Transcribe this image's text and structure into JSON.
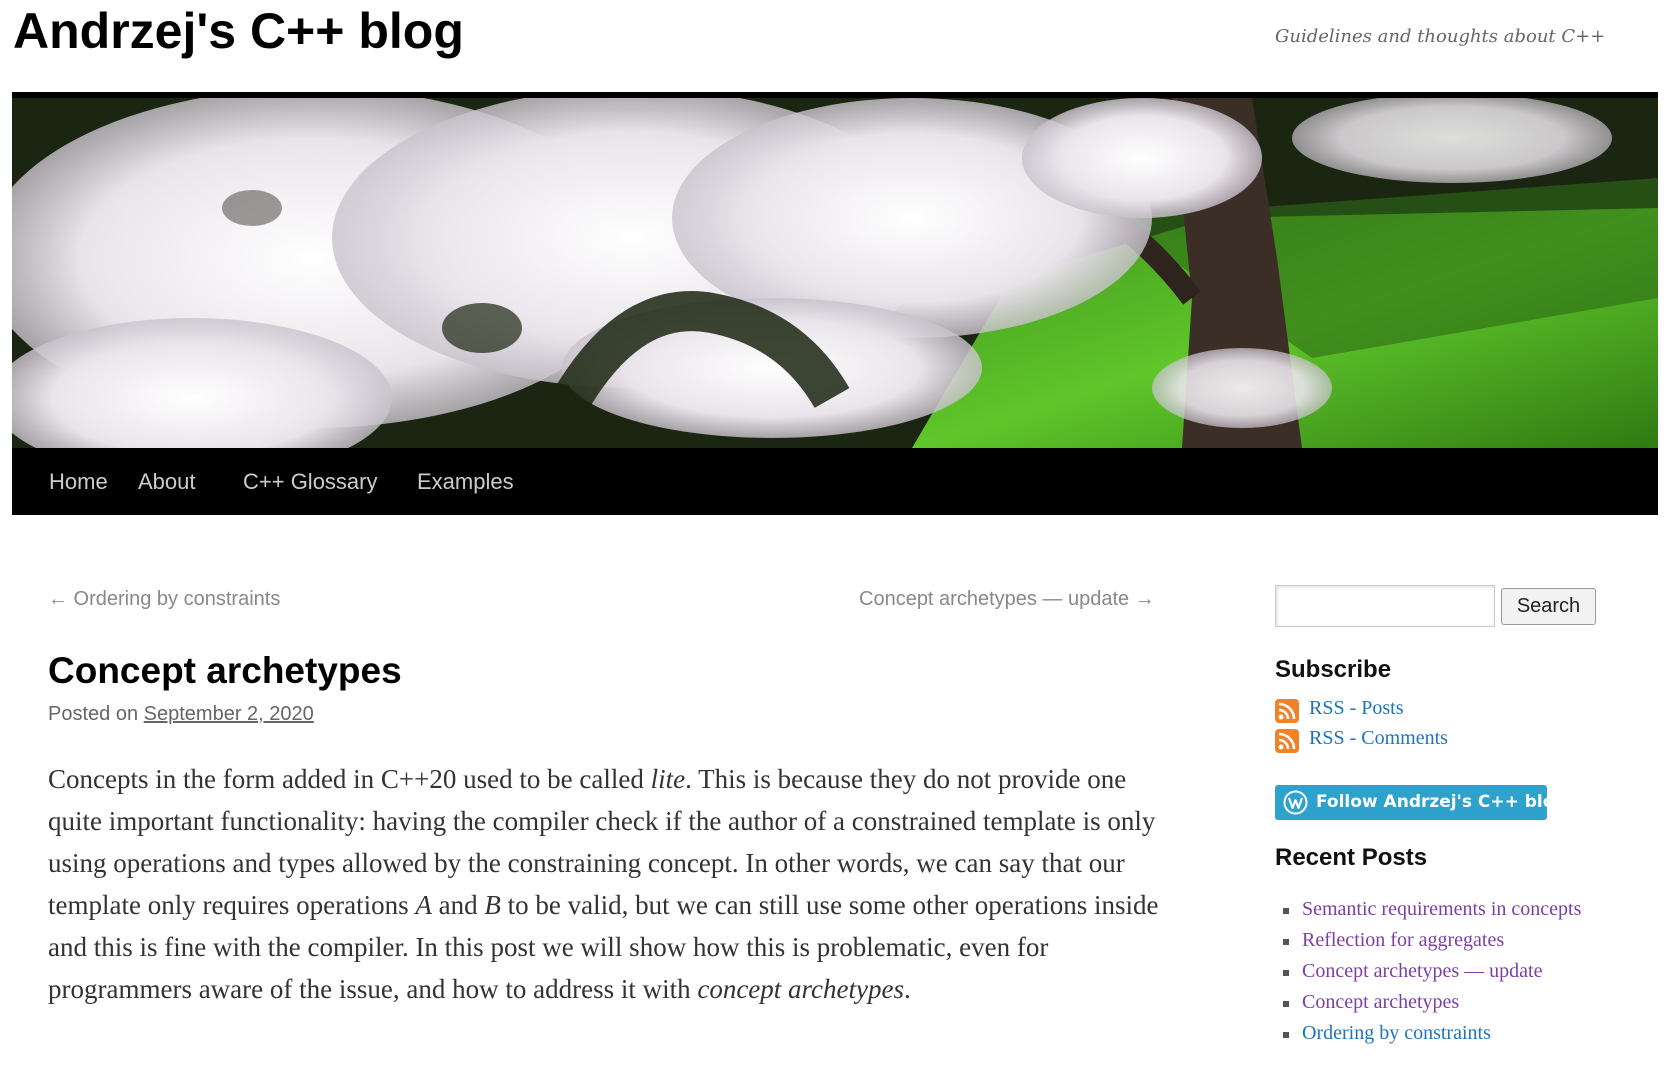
{
  "site": {
    "title": "Andrzej's C++ blog",
    "description": "Guidelines and thoughts about C++"
  },
  "nav": {
    "items": [
      {
        "label": "Home"
      },
      {
        "label": "About"
      },
      {
        "label": "C++ Glossary"
      },
      {
        "label": "Examples"
      }
    ]
  },
  "post_nav": {
    "previous": "← Ordering by constraints",
    "next": "Concept archetypes — update →"
  },
  "post": {
    "title": "Concept archetypes",
    "posted_on": "Posted on",
    "date": "September 2, 2020",
    "body": {
      "t1": "Concepts in the form added in C++20 used to be called ",
      "em1": "lite",
      "t2": ". This is because they do not provide one quite important functionality: having the compiler check if the author of a constrained template is only using operations and types allowed by the constraining concept. In other words, we can say that our template only requires operations ",
      "em2": "A",
      "t3": " and ",
      "em3": "B",
      "t4": " to be valid, but we can still use some other operations inside and this is fine with the compiler. In this post we will show how this is problematic, even for programmers aware of the issue, and how to address it with ",
      "em4": "concept archetypes",
      "t5": "."
    }
  },
  "sidebar": {
    "search": {
      "value": "",
      "placeholder": "",
      "button": "Search"
    },
    "subscribe": {
      "title": "Subscribe",
      "links": [
        {
          "label": "RSS - Posts",
          "icon": "rss-icon"
        },
        {
          "label": "RSS - Comments",
          "icon": "rss-icon"
        }
      ]
    },
    "follow": {
      "label": "Follow Andrzej's C++ blog",
      "icon": "wordpress-icon"
    },
    "recent_posts": {
      "title": "Recent Posts",
      "items": [
        {
          "label": "Semantic requirements in concepts",
          "visited": true
        },
        {
          "label": "Reflection for aggregates",
          "visited": true
        },
        {
          "label": "Concept archetypes — update",
          "visited": true
        },
        {
          "label": "Concept archetypes",
          "visited": true
        },
        {
          "label": "Ordering by constraints",
          "visited": false
        }
      ]
    }
  },
  "colors": {
    "link": "#1e73be",
    "visited_link": "#7b3fa5",
    "nav_background": "#000000",
    "follow_button": "#2ea2cc",
    "rss": "#f0822a"
  }
}
